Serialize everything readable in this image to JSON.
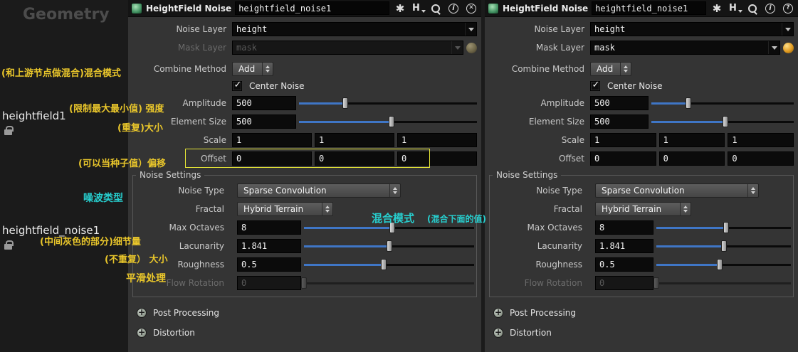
{
  "sidebar": {
    "title": "Geometry",
    "node1": "heightfield1",
    "node2": "heightfield_noise1"
  },
  "annotations": {
    "combine": "(和上游节点做混合)混合模式",
    "amplitude": "(限制最大最小值) 强度",
    "element_size": "(重复)大小",
    "offset": "(可以当种子值）偏移",
    "noise_type": "噪波类型",
    "fractal_main": "混合模式",
    "fractal_sub": "(混合下面的值)",
    "max_octaves": "(中间灰色的部分)细节量",
    "lacunarity": "(不重复） 大小",
    "roughness": "平滑处理"
  },
  "glyphs": {
    "plus": "+",
    "check": "✓"
  },
  "header": {
    "title": "HeightField Noise",
    "name_value": "heightfield_noise1",
    "icons": {
      "gear": "✱",
      "hscript": "H",
      "info": "i",
      "close": "✕",
      "help": "?"
    }
  },
  "params": {
    "noise_layer": {
      "label": "Noise Layer",
      "value": "height"
    },
    "mask_layer": {
      "label": "Mask Layer",
      "value": "mask"
    },
    "combine_method": {
      "label": "Combine Method",
      "value": "Add"
    },
    "center_noise": {
      "label": "Center Noise",
      "checked": true
    },
    "amplitude": {
      "label": "Amplitude",
      "value": "500",
      "slider_pct": 26
    },
    "element_size": {
      "label": "Element Size",
      "value": "500",
      "slider_pct": 52
    },
    "scale": {
      "label": "Scale",
      "values": [
        "1",
        "1",
        "1"
      ]
    },
    "offset": {
      "label": "Offset",
      "values": [
        "0",
        "0",
        "0"
      ]
    },
    "noise_settings": {
      "label": "Noise Settings"
    },
    "noise_type": {
      "label": "Noise Type",
      "value": "Sparse Convolution"
    },
    "fractal": {
      "label": "Fractal",
      "value": "Hybrid Terrain"
    },
    "max_octaves": {
      "label": "Max Octaves",
      "value": "8",
      "slider_pct": 52
    },
    "lacunarity": {
      "label": "Lacunarity",
      "value": "1.841",
      "slider_pct": 50
    },
    "roughness": {
      "label": "Roughness",
      "value": "0.5",
      "slider_pct": 47
    },
    "flow_rotation": {
      "label": "Flow Rotation",
      "value": "0",
      "slider_pct": 0
    },
    "post_processing": {
      "label": "Post Processing"
    },
    "distortion": {
      "label": "Distortion"
    }
  }
}
